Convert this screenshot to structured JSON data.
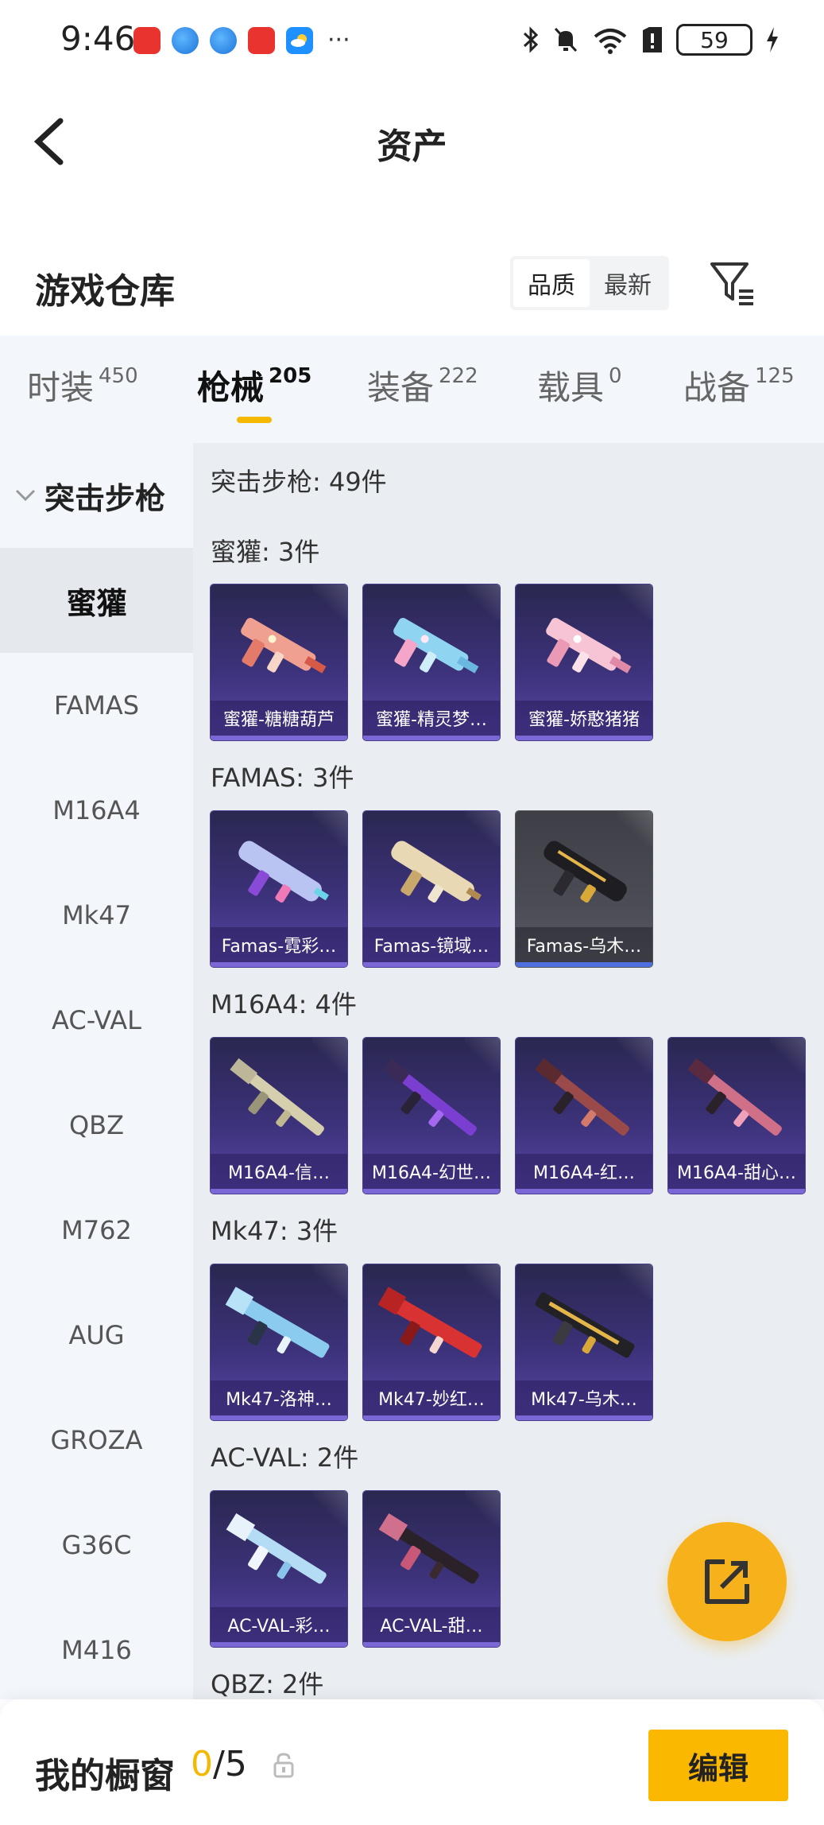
{
  "status": {
    "time": "9:46",
    "battery": "59",
    "apps": [
      "huawei-app",
      "browser-app",
      "browser-app",
      "huawei-app",
      "weather-app"
    ],
    "more": "···"
  },
  "header": {
    "title": "资产"
  },
  "warehouse": {
    "title": "游戏仓库",
    "sort_options": [
      "品质",
      "最新"
    ],
    "active_sort": "品质"
  },
  "tabs": [
    {
      "name": "时装",
      "count": "450"
    },
    {
      "name": "枪械",
      "count": "205"
    },
    {
      "name": "装备",
      "count": "222"
    },
    {
      "name": "载具",
      "count": "0"
    },
    {
      "name": "战备",
      "count": "125"
    }
  ],
  "sidebar": {
    "group": "突击步枪",
    "items": [
      "蜜獾",
      "FAMAS",
      "M16A4",
      "Mk47",
      "AC-VAL",
      "QBZ",
      "M762",
      "AUG",
      "GROZA",
      "G36C",
      "M416"
    ],
    "active": "蜜獾"
  },
  "content": {
    "summary": "突击步枪: 49件",
    "groups": [
      {
        "title": "蜜獾: 3件",
        "items": [
          {
            "label": "蜜獾-糖糖葫芦",
            "tone": "purple"
          },
          {
            "label": "蜜獾-精灵梦…",
            "tone": "purple"
          },
          {
            "label": "蜜獾-娇憨猪猪",
            "tone": "purple"
          }
        ]
      },
      {
        "title": "FAMAS: 3件",
        "items": [
          {
            "label": "Famas-霓彩…",
            "tone": "purple"
          },
          {
            "label": "Famas-镜域…",
            "tone": "purple"
          },
          {
            "label": "Famas-乌木…",
            "tone": "gray"
          }
        ]
      },
      {
        "title": "M16A4: 4件",
        "items": [
          {
            "label": "M16A4-信…",
            "tone": "purple"
          },
          {
            "label": "M16A4-幻世…",
            "tone": "purple"
          },
          {
            "label": "M16A4-红…",
            "tone": "purple"
          },
          {
            "label": "M16A4-甜心…",
            "tone": "purple"
          }
        ]
      },
      {
        "title": "Mk47: 3件",
        "items": [
          {
            "label": "Mk47-洛神…",
            "tone": "purple"
          },
          {
            "label": "Mk47-妙红…",
            "tone": "purple"
          },
          {
            "label": "Mk47-乌木…",
            "tone": "purple"
          }
        ]
      },
      {
        "title": "AC-VAL: 2件",
        "items": [
          {
            "label": "AC-VAL-彩…",
            "tone": "purple"
          },
          {
            "label": "AC-VAL-甜…",
            "tone": "purple"
          }
        ]
      },
      {
        "title": "QBZ: 2件",
        "items": []
      }
    ]
  },
  "bottom": {
    "window_label": "我的橱窗",
    "current": "0",
    "max": "/5",
    "edit_label": "编辑"
  },
  "colors": {
    "accent": "#f5b800",
    "fab": "#f7b21b",
    "card_purple": "#3c327a",
    "card_gray": "#4b4c55"
  }
}
